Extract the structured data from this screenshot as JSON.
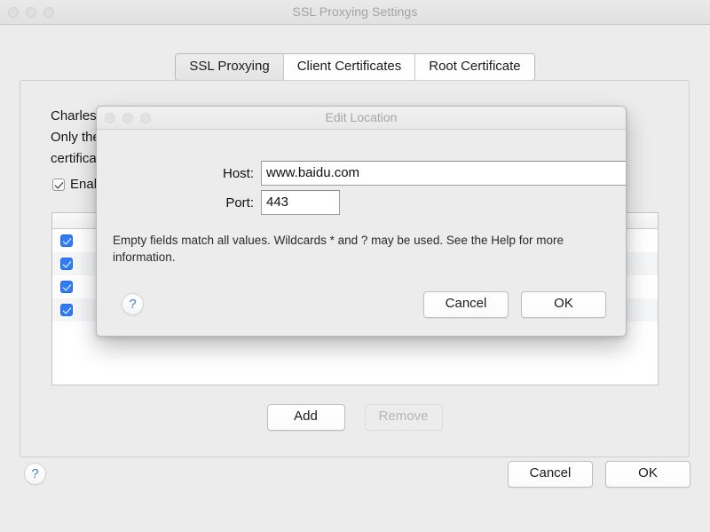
{
  "window": {
    "title": "SSL Proxying Settings",
    "traffic_lights": [
      "close-button",
      "minimize-button",
      "maximize-button"
    ]
  },
  "tabs": [
    {
      "label": "SSL Proxying",
      "selected": true
    },
    {
      "label": "Client Certificates",
      "selected": false
    },
    {
      "label": "Root Certificate",
      "selected": false
    }
  ],
  "panel": {
    "description_line1": "Charles can be used to view the contents of SSL requests and responses.",
    "description_line2": "Only the hosts and ports enabled below will be proxied. Charles' root",
    "description_line3": "certificate must be installed in the client browser or application.",
    "enable_checkbox": {
      "label": "Enable SSL Proxying",
      "checked": true
    },
    "list": {
      "rows": [
        {
          "checked": true,
          "label": ""
        },
        {
          "checked": true,
          "label": ""
        },
        {
          "checked": true,
          "label": ""
        },
        {
          "checked": true,
          "label": ""
        }
      ]
    },
    "add_label": "Add",
    "remove_label": "Remove",
    "remove_disabled": true
  },
  "bottom_bar": {
    "help_glyph": "?",
    "cancel_label": "Cancel",
    "ok_label": "OK"
  },
  "dialog": {
    "title": "Edit Location",
    "traffic_lights": [
      "close-button",
      "minimize-button",
      "maximize-button"
    ],
    "host": {
      "label": "Host:",
      "value": "www.baidu.com",
      "placeholder": ""
    },
    "port": {
      "label": "Port:",
      "value": "443",
      "placeholder": ""
    },
    "hint": "Empty fields match all values. Wildcards * and ? may be used. See the Help for more information.",
    "help_glyph": "?",
    "cancel_label": "Cancel",
    "ok_label": "OK"
  },
  "colors": {
    "window_bg": "#ececec",
    "checkbox_blue": "#2f7cf6",
    "help_blue": "#4a7fc1",
    "title_gray": "#a3a3a3"
  }
}
